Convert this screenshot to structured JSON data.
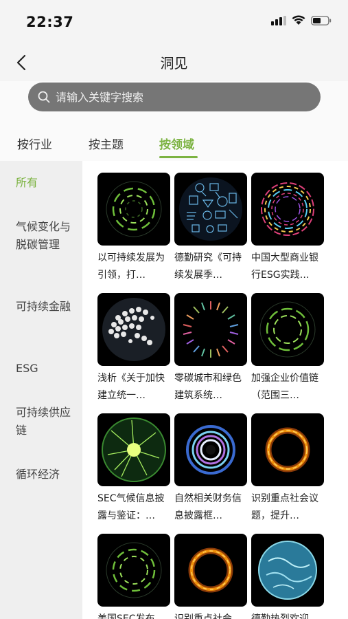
{
  "status": {
    "time": "22:37"
  },
  "nav": {
    "title": "洞见"
  },
  "search": {
    "placeholder": "请输入关键字搜索"
  },
  "tabs": [
    {
      "label": "按行业"
    },
    {
      "label": "按主题"
    },
    {
      "label": "按领域",
      "active": true
    }
  ],
  "sidebar": {
    "items": [
      {
        "label": "所有",
        "active": true
      },
      {
        "label": "气候变化与脱碳管理"
      },
      {
        "label": "可持续金融"
      },
      {
        "label": "ESG"
      },
      {
        "label": "可持续供应链"
      },
      {
        "label": "循环经济"
      }
    ]
  },
  "cards": [
    {
      "title": "以可持续发展为引领，打…",
      "icon": "green-rings-icon"
    },
    {
      "title": "德勤研究《可持续发展季…",
      "icon": "line-icons-globe-icon"
    },
    {
      "title": "中国大型商业银行ESG实践…",
      "icon": "colorful-ring-icon"
    },
    {
      "title": "浅析《关于加快建立统一…",
      "icon": "hexagon-globe-icon"
    },
    {
      "title": "零碳城市和绿色建筑系统…",
      "icon": "radial-bars-icon"
    },
    {
      "title": "加强企业价值链（范围三…",
      "icon": "green-rings-icon"
    },
    {
      "title": "SEC气候信息披露与鉴证：…",
      "icon": "green-plasma-icon"
    },
    {
      "title": "自然相关财务信息披露框…",
      "icon": "blue-ring-icon"
    },
    {
      "title": "识别重点社会议题，提升…",
      "icon": "fire-ring-icon"
    },
    {
      "title": "美国SEC发布气…",
      "icon": "green-rings-icon"
    },
    {
      "title": "识别重点社会…",
      "icon": "fire-ring-icon"
    },
    {
      "title": "德勤热烈欢迎…",
      "icon": "earth-globe-icon"
    }
  ],
  "colors": {
    "accent": "#7cb342",
    "search_bg": "#767676"
  }
}
